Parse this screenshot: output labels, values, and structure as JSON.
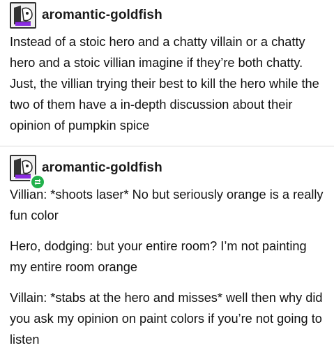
{
  "post1": {
    "username": "aromantic-goldfish",
    "text": "Instead of a stoic hero and a chatty villain or a chatty hero and a stoic villian imagine if they’re both chatty. Just, the villian trying their best to kill the hero while the two of them have a in-depth discussion about their opinion of pumpkin spice"
  },
  "post2": {
    "username": "aromantic-goldfish",
    "paragraphs": [
      "Villian: *shoots laser* No but seriously orange is a really fun color",
      "Hero, dodging: but your entire room? I’m not painting my entire room orange",
      "Villain: *stabs at the hero and misses* well then why did you ask my opinion on paint colors if you’re not going to listen"
    ]
  },
  "icons": {
    "avatar": "avatar-image",
    "reblog": "reblog-icon"
  },
  "colors": {
    "reblog_badge": "#22b14c",
    "avatar_accent": "#8a2be2"
  }
}
